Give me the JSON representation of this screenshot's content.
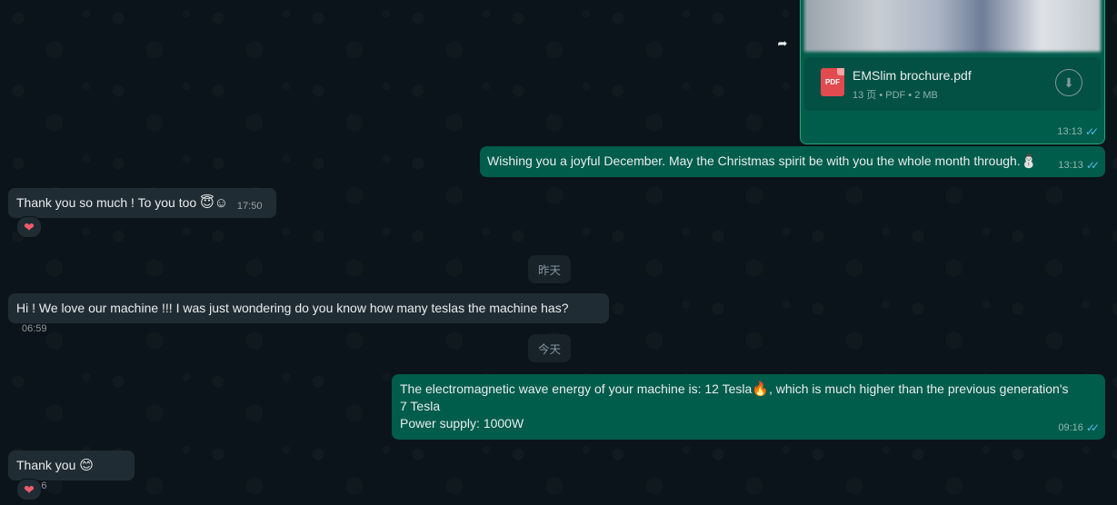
{
  "messages": {
    "doc": {
      "filename": "EMSlim brochure.pdf",
      "info": "13 页 • PDF • 2 MB",
      "icon_label": "PDF",
      "time": "13:13"
    },
    "m1": {
      "text": "Wishing you a joyful December. May the Christmas spirit be with you the whole month through.",
      "emoji": "⛄",
      "time": "13:13"
    },
    "m2": {
      "text": "Thank you so much ! To you too",
      "emoji": "😇☺",
      "time": "17:50",
      "reaction": "❤"
    },
    "date1": "昨天",
    "m3": {
      "text": "Hi ! We love our machine !!! I was just wondering do you know how many teslas the machine has?",
      "time": "06:59"
    },
    "date2": "今天",
    "m4": {
      "text_part1": "The electromagnetic wave energy of your machine is: 12 Tesla",
      "emoji": "🔥",
      "text_part2": ", which is much higher than the previous generation's 7 Tesla",
      "line2": "Power supply: 1000W",
      "time": "09:16"
    },
    "m5": {
      "text": "Thank you",
      "emoji": "😊",
      "time": "09:16",
      "reaction": "❤"
    }
  },
  "icons": {
    "forward": "forward-arrow-icon",
    "download": "download-icon",
    "read_receipt": "double-check-icon",
    "reaction": "heart-icon"
  },
  "colors": {
    "background": "#0b141a",
    "incoming": "#202c33",
    "outgoing": "#005c4b",
    "read_tick": "#53bdeb",
    "pdf": "#e14b4f"
  }
}
